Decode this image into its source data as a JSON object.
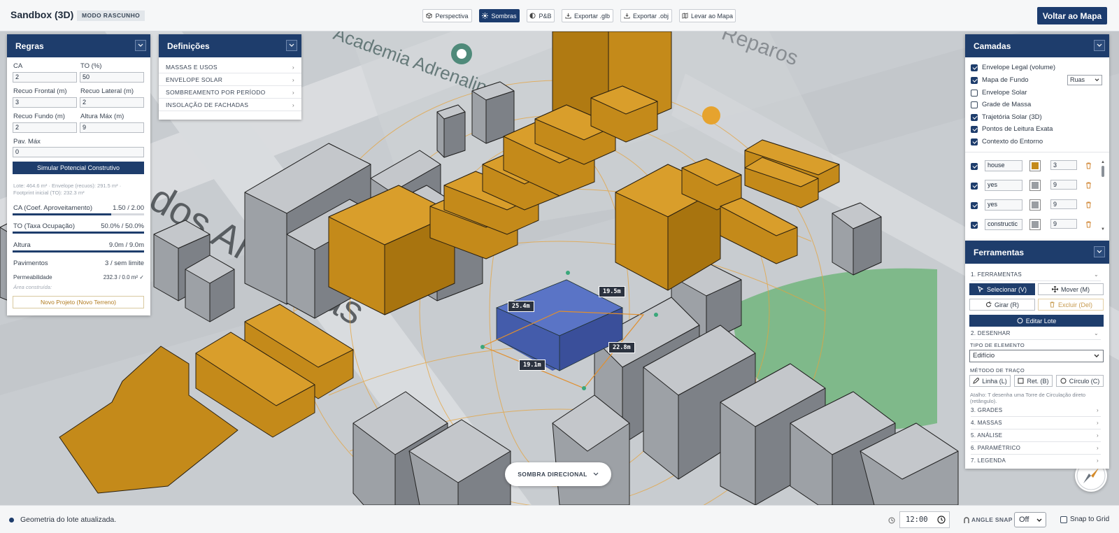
{
  "app": {
    "title": "Sandbox (3D)",
    "mode_badge": "MODO RASCUNHO",
    "back_button": "Voltar ao Mapa"
  },
  "toolbar": [
    {
      "label": "Perspectiva",
      "icon": "cube-icon",
      "active": false
    },
    {
      "label": "Sombras",
      "icon": "sun-icon",
      "active": true
    },
    {
      "label": "P&B",
      "icon": "contrast-icon",
      "active": false
    },
    {
      "label": "Exportar .glb",
      "icon": "download-icon",
      "active": false
    },
    {
      "label": "Exportar .obj",
      "icon": "download-icon",
      "active": false
    },
    {
      "label": "Levar ao Mapa",
      "icon": "map-icon",
      "active": false
    }
  ],
  "regras": {
    "title": "Regras",
    "fields": [
      {
        "label": "CA",
        "value": "2"
      },
      {
        "label": "TO (%)",
        "value": "50"
      },
      {
        "label": "Recuo Frontal (m)",
        "value": "3"
      },
      {
        "label": "Recuo Lateral (m)",
        "value": "2"
      },
      {
        "label": "Recuo Fundo (m)",
        "value": "2"
      },
      {
        "label": "Altura Máx (m)",
        "value": "9"
      },
      {
        "label": "Pav. Máx",
        "value": "0"
      }
    ],
    "simulate_button": "Simular Potencial Construtivo",
    "summary_line1": "Lote: 464.6 m² · Envelope (recuos): 291.5 m² ·",
    "summary_line2": "Footprint inicial (TO): 232.3 m²",
    "metrics": [
      {
        "label": "CA (Coef. Aproveitamento)",
        "value": "1.50 / 2.00",
        "progress": 0.75
      },
      {
        "label": "TO (Taxa Ocupação)",
        "value": "50.0% / 50.0%",
        "progress": 1.0
      },
      {
        "label": "Altura",
        "value": "9.0m / 9.0m",
        "progress": 1.0
      },
      {
        "label": "Pavimentos",
        "value": "3 / sem limite"
      }
    ],
    "permeabilidade_label": "Permeabilidade",
    "permeabilidade_value": "232.3 / 0.0 m² ✓",
    "area_construida_label": "Área construída:",
    "new_project_button": "Novo Projeto (Novo Terreno)"
  },
  "definicoes": {
    "title": "Definições",
    "items": [
      "MASSAS E USOS",
      "ENVELOPE SOLAR",
      "SOMBREAMENTO POR PERÍODO",
      "INSOLAÇÃO DE FACHADAS"
    ]
  },
  "camadas": {
    "title": "Camadas",
    "layers": [
      {
        "label": "Envelope Legal (volume)",
        "checked": true
      },
      {
        "label": "Mapa de Fundo",
        "checked": true
      },
      {
        "label": "Envelope Solar",
        "checked": false
      },
      {
        "label": "Grade de Massa",
        "checked": false
      },
      {
        "label": "Trajetória Solar (3D)",
        "checked": true
      },
      {
        "label": "Pontos de Leitura Exata",
        "checked": true
      },
      {
        "label": "Contexto do Entorno",
        "checked": true
      }
    ],
    "basemap_select": "Ruas",
    "objects": [
      {
        "name": "house",
        "color": "#c48a1a",
        "floors": "3",
        "checked": true
      },
      {
        "name": "yes",
        "color": "#9a9ea3",
        "floors": "9",
        "checked": true
      },
      {
        "name": "yes",
        "color": "#9a9ea3",
        "floors": "9",
        "checked": true
      },
      {
        "name": "constructic",
        "color": "#9a9ea3",
        "floors": "9",
        "checked": true
      }
    ]
  },
  "ferramentas": {
    "title": "Ferramentas",
    "section_tools": "1. FERRAMENTAS",
    "select_button": "Selecionar (V)",
    "move_button": "Mover (M)",
    "rotate_button": "Girar (R)",
    "delete_button": "Excluir (Del)",
    "edit_lot_button": "Editar Lote",
    "section_draw": "2. DESENHAR",
    "element_type_label": "TIPO DE ELEMENTO",
    "element_type_value": "Edifício",
    "trace_method_label": "MÉTODO DE TRAÇO",
    "line_button": "Linha (L)",
    "rect_button": "Ret. (B)",
    "circle_button": "Círculo (C)",
    "hint": "Atalho: T desenha uma Torre de Circulação direto (retângulo).",
    "sections": [
      "3. GRADES",
      "4. MASSAS",
      "5. ANÁLISE",
      "6. PARAMÉTRICO",
      "7. LEGENDA"
    ]
  },
  "scene": {
    "measurements": [
      "25.4m",
      "19.5m",
      "22.8m",
      "19.1m"
    ],
    "street_labels": [
      "Academia Adrenalina",
      "Reparos",
      "dos Andradas"
    ],
    "shadow_mode_button": "SOMBRA DIRECIONAL"
  },
  "status": {
    "message": "Geometria do lote atualizada.",
    "time": "12:00",
    "angle_snap_label": "ANGLE SNAP",
    "angle_snap_value": "Off",
    "snap_to_grid_label": "Snap to Grid"
  },
  "colors": {
    "accent": "#1e3d6c",
    "building_highlight": "#c48a1a",
    "building_context": "#9a9ea3",
    "selected_mass": "#3a4f9a"
  }
}
